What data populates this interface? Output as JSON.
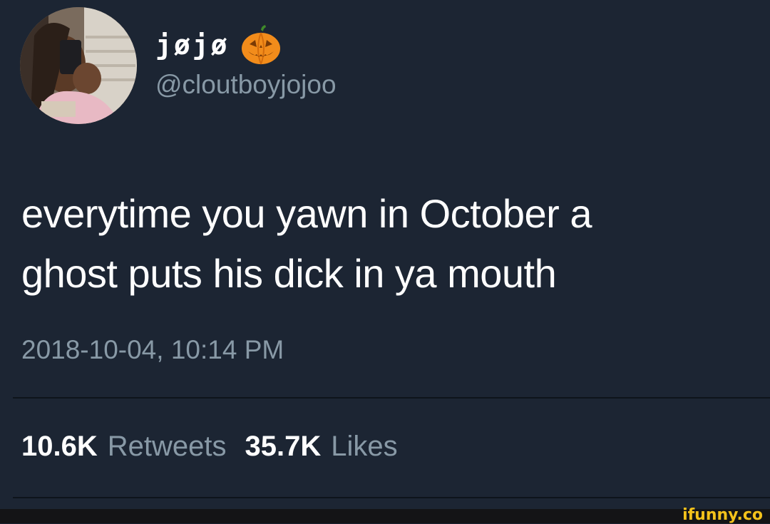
{
  "tweet": {
    "display_name": "jøjø",
    "name_emoji": "jack-o-lantern-icon",
    "handle": "@cloutboyjojoo",
    "text_line_1": "everytime you yawn in October a",
    "text_line_2": "ghost puts his dick in ya mouth",
    "timestamp": "2018-10-04, 10:14 PM",
    "retweets": {
      "count": "10.6K",
      "label": "Retweets"
    },
    "likes": {
      "count": "35.7K",
      "label": "Likes"
    }
  },
  "watermark": "ifunny.co",
  "colors": {
    "background": "#1c2533",
    "primary_text": "#ffffff",
    "secondary_text": "#8899a6",
    "watermark": "#f4c21b"
  }
}
